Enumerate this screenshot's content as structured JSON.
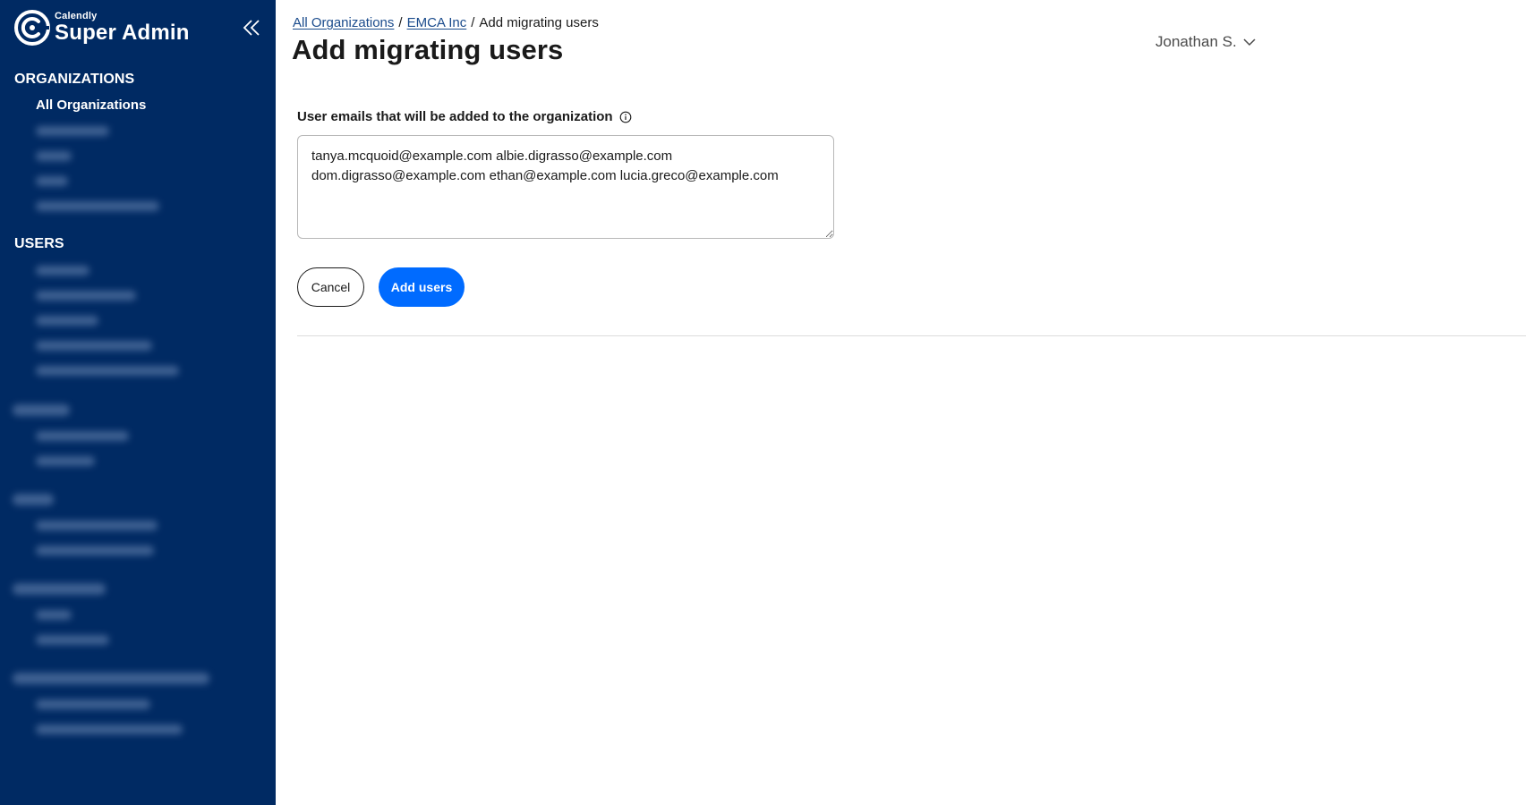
{
  "sidebar": {
    "brand": {
      "small": "Calendly",
      "big": "Super Admin",
      "logo_icon": "calendly-logo-icon"
    },
    "collapse_icon": "double-chevron-left-icon",
    "sections": [
      {
        "title": "ORGANIZATIONS",
        "items": [
          {
            "label": "All Organizations",
            "active": true
          }
        ],
        "redacted_items": 4
      },
      {
        "title": "USERS",
        "items": [],
        "redacted_items": 5
      }
    ],
    "redacted_sections": 4
  },
  "breadcrumb": {
    "items": [
      {
        "label": "All Organizations",
        "link": true
      },
      {
        "label": "EMCA Inc",
        "link": true
      },
      {
        "label": "Add migrating users",
        "link": false
      }
    ],
    "separator": "/"
  },
  "page": {
    "title": "Add migrating users"
  },
  "user_menu": {
    "name": "Jonathan S.",
    "icon": "chevron-down-icon"
  },
  "form": {
    "label": "User emails that will be added to the organization",
    "info_icon": "info-icon",
    "emails_value": "tanya.mcquoid@example.com albie.digrasso@example.com dom.digrasso@example.com ethan@example.com lucia.greco@example.com",
    "cancel_label": "Cancel",
    "submit_label": "Add users"
  },
  "colors": {
    "sidebar_bg": "#002a63",
    "primary": "#006bff",
    "link": "#1a4b8c"
  }
}
